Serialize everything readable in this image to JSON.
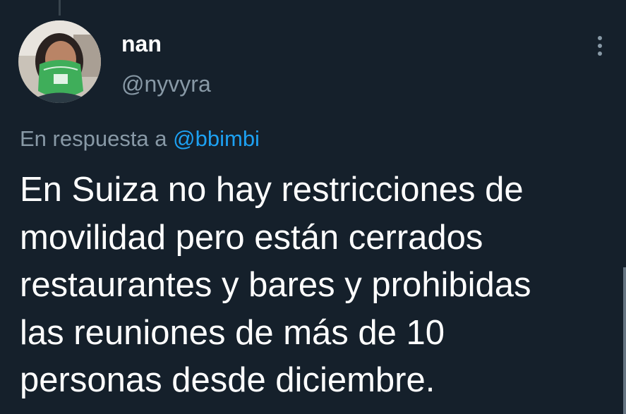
{
  "author": {
    "display_name": "nan",
    "handle": "@nyvyra",
    "avatar_icon": "profile-photo"
  },
  "reply": {
    "prefix": "En respuesta a",
    "mention": "@bbimbi"
  },
  "tweet": {
    "lines": [
      "En Suiza no hay restricciones de",
      "movilidad pero están cerrados",
      "restaurantes y bares y prohibidas",
      "las reuniones de más de 10",
      "personas desde diciembre."
    ]
  },
  "icons": {
    "more": "more-vertical-icon"
  },
  "colors": {
    "background": "#15202b",
    "primary_text": "#ffffff",
    "secondary_text": "#8899a6",
    "accent": "#1da1f2"
  }
}
